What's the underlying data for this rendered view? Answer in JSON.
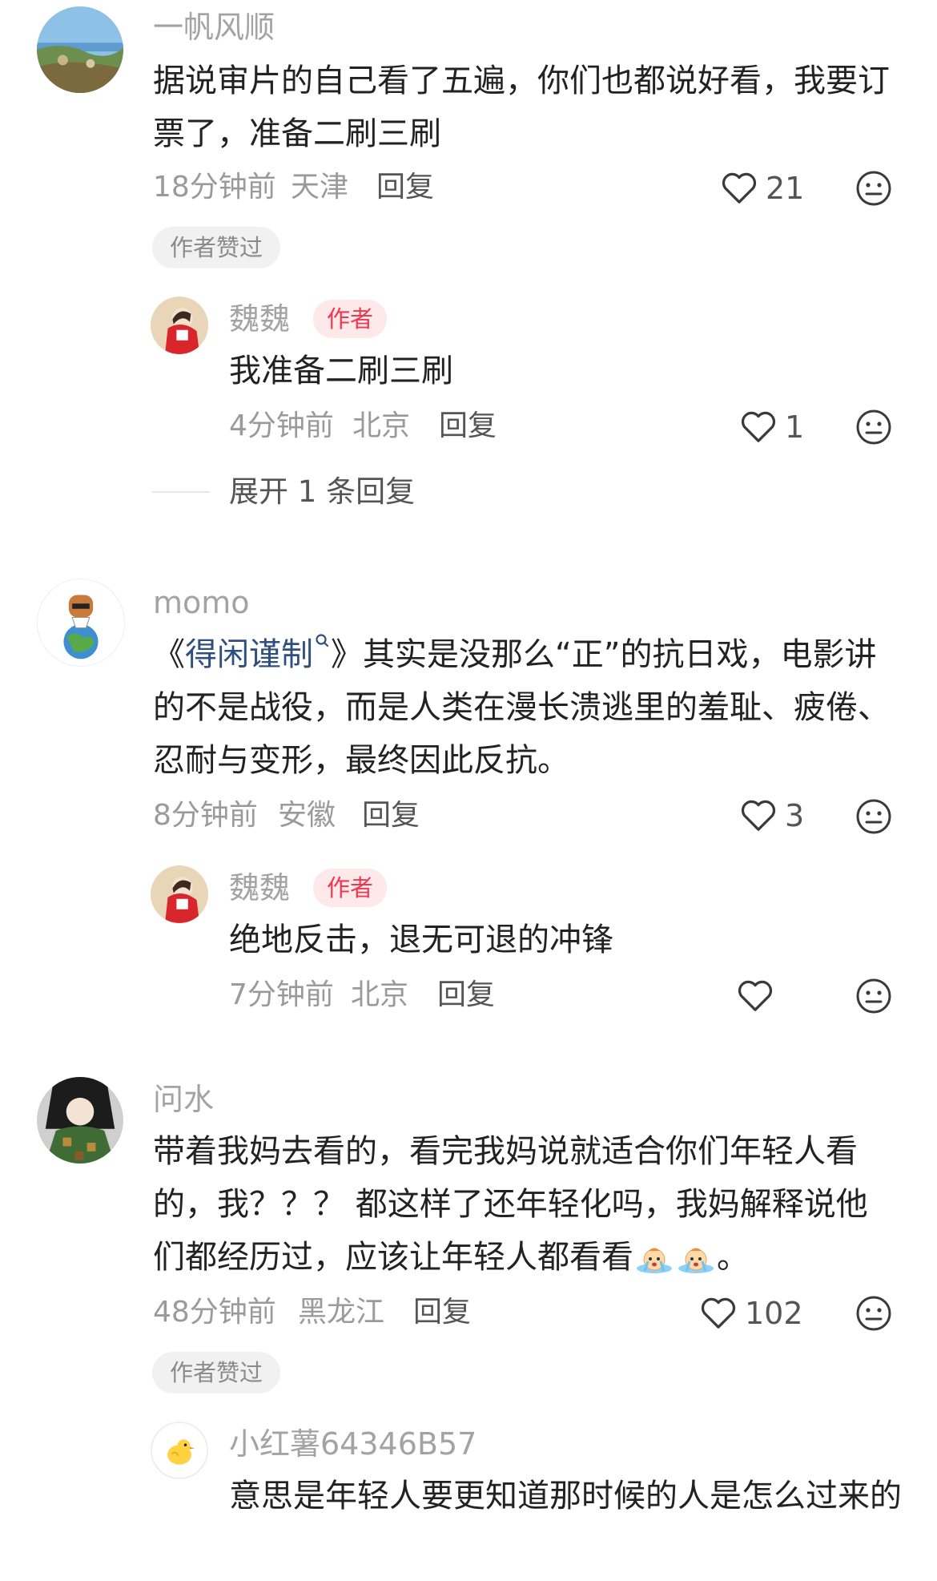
{
  "comments": [
    {
      "user": "一帆风顺",
      "text": "据说审片的自己看了五遍，你们也都说好看，我要订票了，准备二刷三刷",
      "time": "18分钟前",
      "location": "天津",
      "reply_label": "回复",
      "likes": "21",
      "liked_by_author": "作者赞过",
      "replies": [
        {
          "user": "魏魏",
          "badge": "作者",
          "text": "我准备二刷三刷",
          "time": "4分钟前",
          "location": "北京",
          "reply_label": "回复",
          "likes": "1"
        }
      ],
      "expand_label": "展开 1 条回复"
    },
    {
      "user": "momo",
      "text_prefix": "《",
      "link_text": "得闲谨制",
      "text_suffix": "》其实是没那么“正”的抗日戏，电影讲的不是战役，而是人类在漫长溃逃里的羞耻、疲倦、忍耐与变形，最终因此反抗。",
      "time": "8分钟前",
      "location": "安徽",
      "reply_label": "回复",
      "likes": "3",
      "replies": [
        {
          "user": "魏魏",
          "badge": "作者",
          "text": "绝地反击，退无可退的冲锋",
          "time": "7分钟前",
          "location": "北京",
          "reply_label": "回复",
          "likes": ""
        }
      ]
    },
    {
      "user": "问水",
      "text": "带着我妈去看的，看完我妈说就适合你们年轻人看的，我？？？ 都这样了还年轻化吗，我妈解释说他们都经历过，应该让年轻人都看看",
      "text_end": "。",
      "emoji": "crying-emoji",
      "time": "48分钟前",
      "location": "黑龙江",
      "reply_label": "回复",
      "likes": "102",
      "liked_by_author": "作者赞过",
      "replies": [
        {
          "user": "小红薯64346B57",
          "text": "意思是年轻人要更知道那时候的人是怎么过来的"
        }
      ]
    }
  ],
  "icons": {
    "like": "heart-outline-icon",
    "dislike": "neutral-face-icon"
  },
  "colors": {
    "badge_text": "#f2364f",
    "badge_bg": "#fde8ea",
    "link": "#2f4f7f",
    "meta": "#9a9a9a"
  }
}
